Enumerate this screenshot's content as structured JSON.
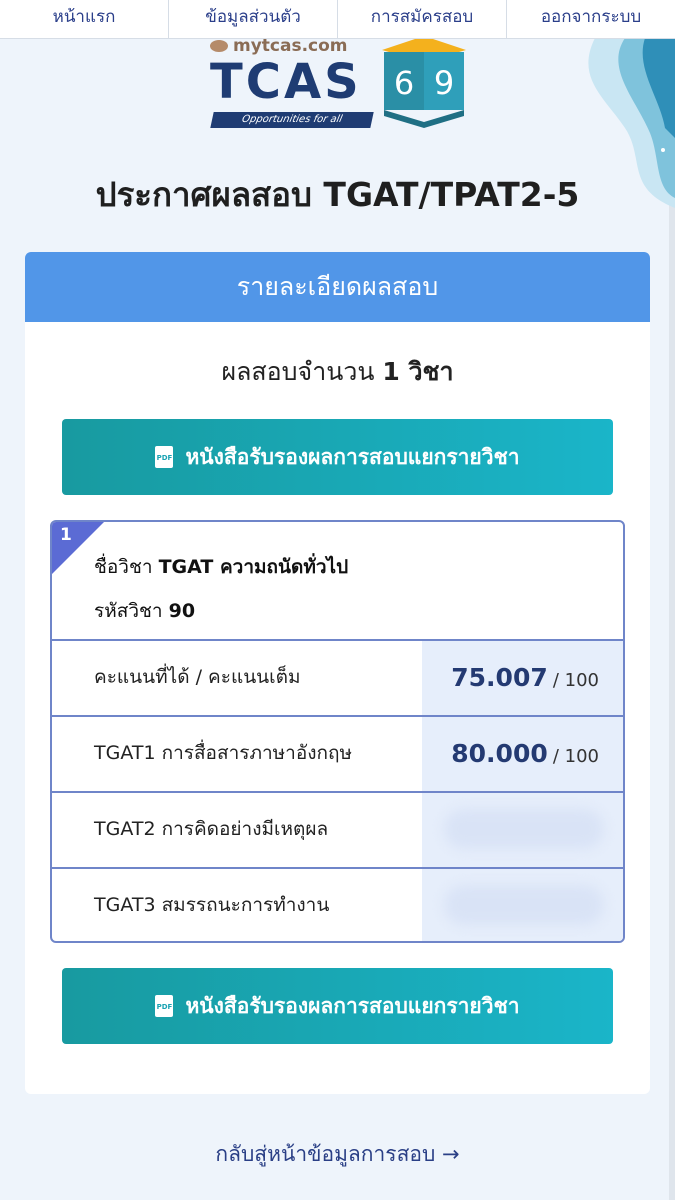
{
  "nav": {
    "items": [
      "หน้าแรก",
      "ข้อมูลส่วนตัว",
      "การสมัครสอบ",
      "ออกจากระบบ"
    ]
  },
  "logo": {
    "site": "mytcas.com",
    "word": "TCAS",
    "year": "69",
    "tagline": "Opportunities for all"
  },
  "page_title": "ประกาศผลสอบ TGAT/TPAT2-5",
  "card": {
    "header": "รายละเอียดผลสอบ",
    "count_prefix": "ผลสอบจำนวน",
    "count_value": "1 วิชา",
    "pdf_button_label": "หนังสือรับรองผลการสอบแยกรายวิชา",
    "pdf_icon_text": "PDF"
  },
  "subject": {
    "index": "1",
    "name_prefix": "ชื่อวิชา",
    "name_value": "TGAT ความถนัดทั่วไป",
    "code_prefix": "รหัสวิชา",
    "code_value": "90",
    "rows": [
      {
        "label": "คะแนนที่ได้ / คะแนนเต็ม",
        "score": "75.007",
        "max": "/ 100"
      },
      {
        "label": "TGAT1 การสื่อสารภาษาอังกฤษ",
        "score": "80.000",
        "max": "/ 100"
      },
      {
        "label": "TGAT2 การคิดอย่างมีเหตุผล",
        "score": "",
        "max": ""
      },
      {
        "label": "TGAT3 สมรรถนะการทำงาน",
        "score": "",
        "max": ""
      }
    ]
  },
  "back_link": "กลับสู่หน้าข้อมูลการสอบ →",
  "colors": {
    "header_blue": "#5196e8",
    "button_teal": "#1ab5c9",
    "score_navy": "#243a72"
  }
}
